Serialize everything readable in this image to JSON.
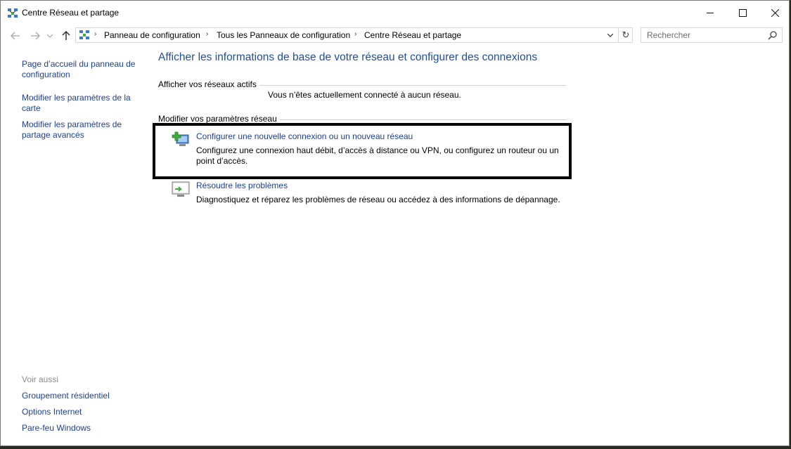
{
  "window": {
    "title": "Centre Réseau et partage",
    "icon": "network-center-icon"
  },
  "nav": {
    "back_icon": "back-arrow-icon",
    "forward_icon": "forward-arrow-icon",
    "up_icon": "up-arrow-icon",
    "breadcrumbs": [
      "Panneau de configuration",
      "Tous les Panneaux de configuration",
      "Centre Réseau et partage"
    ]
  },
  "search": {
    "placeholder": "Rechercher"
  },
  "sidebar": {
    "links": [
      "Page d’accueil du panneau de configuration",
      "Modifier les paramètres de la carte",
      "Modifier les paramètres de partage avancés"
    ],
    "see_also_label": "Voir aussi",
    "see_also": [
      "Groupement résidentiel",
      "Options Internet",
      "Pare-feu Windows"
    ]
  },
  "main": {
    "title": "Afficher les informations de base de votre réseau et configurer des connexions",
    "active_networks_label": "Afficher vos réseaux actifs",
    "not_connected": "Vous n’êtes actuellement connecté à aucun réseau.",
    "change_settings_label": "Modifier vos paramètres réseau",
    "tasks": [
      {
        "icon": "new-connection-icon",
        "link": "Configurer une nouvelle connexion ou un nouveau réseau",
        "desc": "Configurez une connexion haut débit, d’accès à distance ou VPN, ou configurez un routeur ou un point d’accès."
      },
      {
        "icon": "troubleshoot-icon",
        "link": "Résoudre les problèmes",
        "desc": "Diagnostiquez et réparez les problèmes de réseau ou accédez à des informations de dépannage."
      }
    ]
  },
  "colors": {
    "link": "#1a3f9c",
    "title": "#1e4e9e",
    "highlight_border": "#000000"
  }
}
